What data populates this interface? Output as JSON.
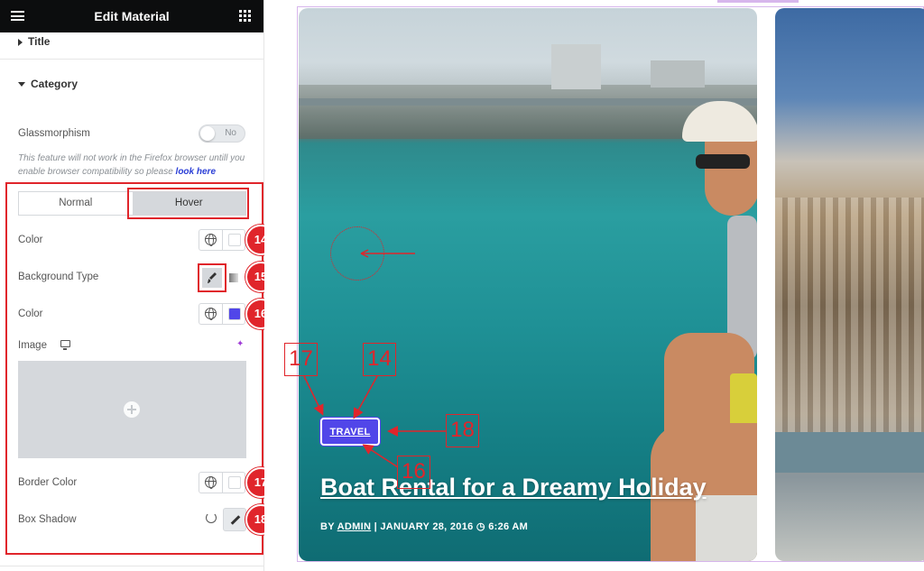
{
  "header": {
    "title": "Edit Material",
    "menu_icon": "hamburger-icon",
    "apps_icon": "grid-icon"
  },
  "sections": {
    "title_label": "Title",
    "category_label": "Category"
  },
  "glassmorphism": {
    "label": "Glassmorphism",
    "toggle_text": "No",
    "note": "This feature will not work in the Firefox browser untill you enable browser compatibility so please ",
    "note_link": "look here"
  },
  "tabs": {
    "normal": "Normal",
    "hover": "Hover",
    "active": "Hover"
  },
  "controls": {
    "color_label": "Color",
    "background_type_label": "Background Type",
    "color2_label": "Color",
    "image_label": "Image",
    "border_color_label": "Border Color",
    "box_shadow_label": "Box Shadow"
  },
  "colors": {
    "accent": "#5146e9",
    "annotation": "#e0252b",
    "topbar": "#0c0d0e",
    "color_swatch": "#ffffff",
    "color2_swatch": "#5146e9",
    "border_color_swatch": "#ffffff"
  },
  "badges": {
    "b14": "14",
    "b15": "15",
    "b16": "16",
    "b17": "17",
    "b18": "18"
  },
  "preview": {
    "category": "TRAVEL",
    "post_title": "Boat Rental for a Dreamy Holiday",
    "meta_by": "BY",
    "meta_author": "ADMIN",
    "meta_sep": "|",
    "meta_date": "JANUARY 28, 2016",
    "meta_time": "6:26 AM"
  },
  "annotations": {
    "n17": "17",
    "n14": "14",
    "n18": "18",
    "n16": "16"
  }
}
